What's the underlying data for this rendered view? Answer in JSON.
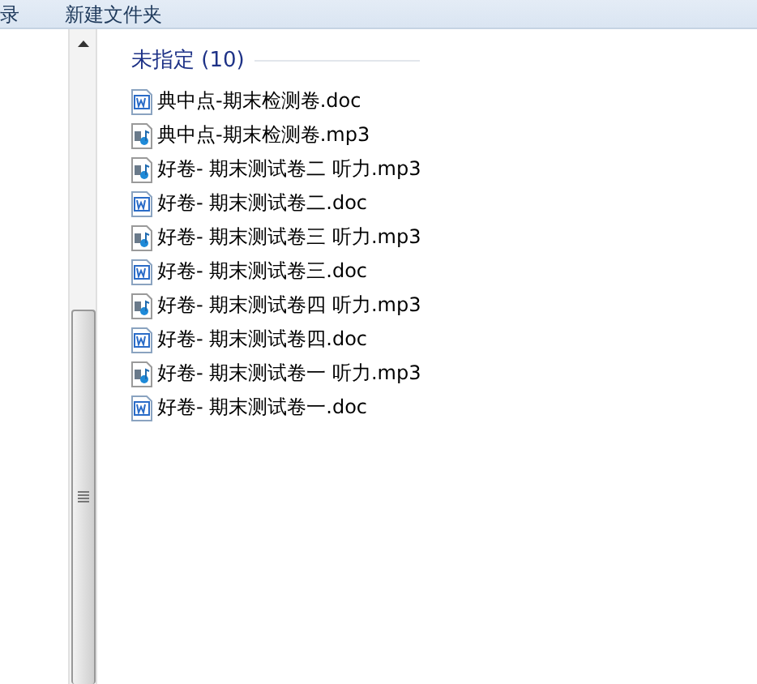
{
  "toolbar": {
    "buttons": [
      "录",
      "新建文件夹"
    ]
  },
  "group": {
    "title": "未指定 (10)",
    "files": [
      {
        "name": "典中点-期末检测卷.doc",
        "kind": "doc"
      },
      {
        "name": "典中点-期末检测卷.mp3",
        "kind": "audio"
      },
      {
        "name": "好卷- 期末测试卷二 听力.mp3",
        "kind": "audio"
      },
      {
        "name": "好卷- 期末测试卷二.doc",
        "kind": "doc"
      },
      {
        "name": "好卷- 期末测试卷三 听力.mp3",
        "kind": "audio"
      },
      {
        "name": "好卷- 期末测试卷三.doc",
        "kind": "doc"
      },
      {
        "name": "好卷- 期末测试卷四 听力.mp3",
        "kind": "audio"
      },
      {
        "name": "好卷- 期末测试卷四.doc",
        "kind": "doc"
      },
      {
        "name": "好卷- 期末测试卷一 听力.mp3",
        "kind": "audio"
      },
      {
        "name": "好卷- 期末测试卷一.doc",
        "kind": "doc"
      }
    ]
  }
}
